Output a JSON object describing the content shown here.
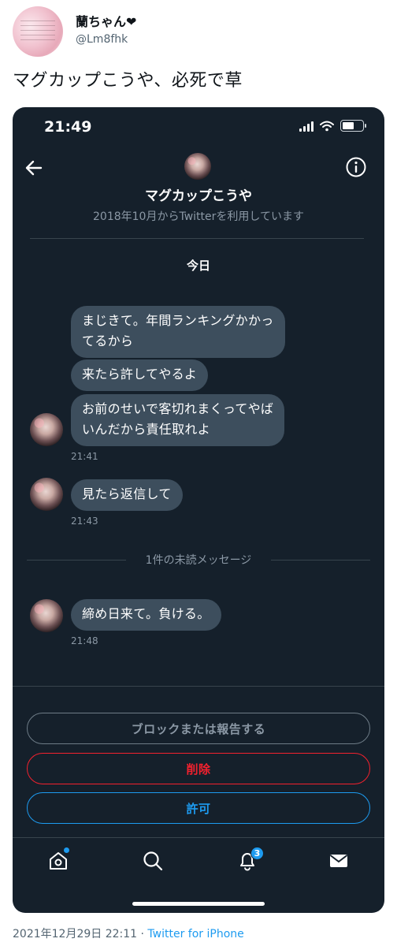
{
  "tweet": {
    "author_name": "蘭ちゃん❤",
    "author_handle": "@Lm8fhk",
    "text": "マグカップこうや、必死で草",
    "date": "2021年12月29日 22:11",
    "separator": " · ",
    "source": "Twitter for iPhone"
  },
  "screenshot": {
    "status_time": "21:49",
    "conversation": {
      "name": "マグカップこうや",
      "joined": "2018年10月からTwitterを利用しています",
      "day_label": "今日",
      "unread_label": "1件の未読メッセージ"
    },
    "messages": [
      {
        "text": "まじきて。年間ランキングかかっ\nてるから"
      },
      {
        "text": "来たら許してやるよ"
      },
      {
        "text": "お前のせいで客切れまくってやば\nいんだから責任取れよ"
      },
      {
        "text": "見たら返信して"
      },
      {
        "text": "締め日来て。負ける。"
      }
    ],
    "timestamps": [
      "21:41",
      "21:43",
      "21:48"
    ],
    "actions": {
      "block_report": "ブロックまたは報告する",
      "delete": "削除",
      "allow": "許可"
    },
    "nav": {
      "notification_count": "3"
    }
  },
  "colors": {
    "background_dark": "#15202b",
    "bubble": "#3d4e5d",
    "accent_blue": "#1d9bf0",
    "danger_red": "#f4212e"
  }
}
